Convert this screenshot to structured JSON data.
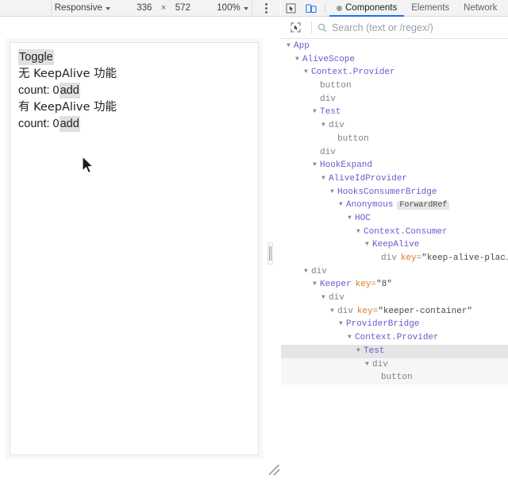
{
  "device_toolbar": {
    "preset_label": "Responsive",
    "width_value": "336",
    "x_separator": "×",
    "height_value": "572",
    "zoom_label": "100%",
    "menu_icon": "kebab-menu-icon"
  },
  "page": {
    "toggle_button": "Toggle",
    "lines": [
      {
        "text": "无 KeepAlive 功能"
      },
      {
        "prefix": "count: 0",
        "button": "add"
      },
      {
        "text": "有 KeepAlive 功能"
      },
      {
        "prefix": "count: 0",
        "button": "add"
      }
    ]
  },
  "devtools": {
    "inspect_icon": "inspect-element-icon",
    "device_toggle_icon": "device-toolbar-icon",
    "tabs": [
      {
        "label": "Components",
        "active": true,
        "has_dot": true
      },
      {
        "label": "Elements",
        "active": false,
        "has_dot": false
      },
      {
        "label": "Network",
        "active": false,
        "has_dot": false
      }
    ],
    "search": {
      "select_icon": "select-component-icon",
      "search_icon": "search-icon",
      "placeholder": "Search (text or /regex/)",
      "value": ""
    },
    "tree": [
      {
        "indent": 0,
        "arrow": "down",
        "name": "App",
        "kind": "component"
      },
      {
        "indent": 1,
        "arrow": "down",
        "name": "AliveScope",
        "kind": "component"
      },
      {
        "indent": 2,
        "arrow": "down",
        "name": "Context.Provider",
        "kind": "component"
      },
      {
        "indent": 3,
        "arrow": "none",
        "name": "button",
        "kind": "host"
      },
      {
        "indent": 3,
        "arrow": "none",
        "name": "div",
        "kind": "host"
      },
      {
        "indent": 3,
        "arrow": "down",
        "name": "Test",
        "kind": "component"
      },
      {
        "indent": 4,
        "arrow": "down",
        "name": "div",
        "kind": "host"
      },
      {
        "indent": 5,
        "arrow": "none",
        "name": "button",
        "kind": "host"
      },
      {
        "indent": 3,
        "arrow": "none",
        "name": "div",
        "kind": "host"
      },
      {
        "indent": 3,
        "arrow": "down",
        "name": "HookExpand",
        "kind": "component"
      },
      {
        "indent": 4,
        "arrow": "down",
        "name": "AliveIdProvider",
        "kind": "component"
      },
      {
        "indent": 5,
        "arrow": "down",
        "name": "HooksConsumerBridge",
        "kind": "component"
      },
      {
        "indent": 6,
        "arrow": "down",
        "name": "Anonymous",
        "kind": "component",
        "badge": "ForwardRef"
      },
      {
        "indent": 7,
        "arrow": "down",
        "name": "HOC",
        "kind": "component"
      },
      {
        "indent": 8,
        "arrow": "down",
        "name": "Context.Consumer",
        "kind": "component"
      },
      {
        "indent": 9,
        "arrow": "down",
        "name": "KeepAlive",
        "kind": "component"
      },
      {
        "indent": 10,
        "arrow": "none",
        "name": "div",
        "kind": "host",
        "key_label": "key=",
        "key_value": "\"keep-alive-plac…\""
      },
      {
        "indent": 2,
        "arrow": "down",
        "name": "div",
        "kind": "host"
      },
      {
        "indent": 3,
        "arrow": "down",
        "name": "Keeper",
        "kind": "component",
        "key_label": "key=",
        "key_value": "\"8\""
      },
      {
        "indent": 4,
        "arrow": "down",
        "name": "div",
        "kind": "host"
      },
      {
        "indent": 5,
        "arrow": "down",
        "name": "div",
        "kind": "host",
        "key_label": "key=",
        "key_value": "\"keeper-container\""
      },
      {
        "indent": 6,
        "arrow": "down",
        "name": "ProviderBridge",
        "kind": "component"
      },
      {
        "indent": 7,
        "arrow": "down",
        "name": "Context.Provider",
        "kind": "component"
      },
      {
        "indent": 8,
        "arrow": "down",
        "name": "Test",
        "kind": "component",
        "state": "selected"
      },
      {
        "indent": 9,
        "arrow": "down",
        "name": "div",
        "kind": "host",
        "state": "subhl"
      },
      {
        "indent": 10,
        "arrow": "none",
        "name": "button",
        "kind": "host",
        "state": "subhl"
      }
    ]
  },
  "colors": {
    "accent": "#1a73e8",
    "component_name": "#6a5acd",
    "host_name": "#7d8085",
    "prop_key": "#d97d28",
    "selected_row": "#e5e5e5"
  }
}
